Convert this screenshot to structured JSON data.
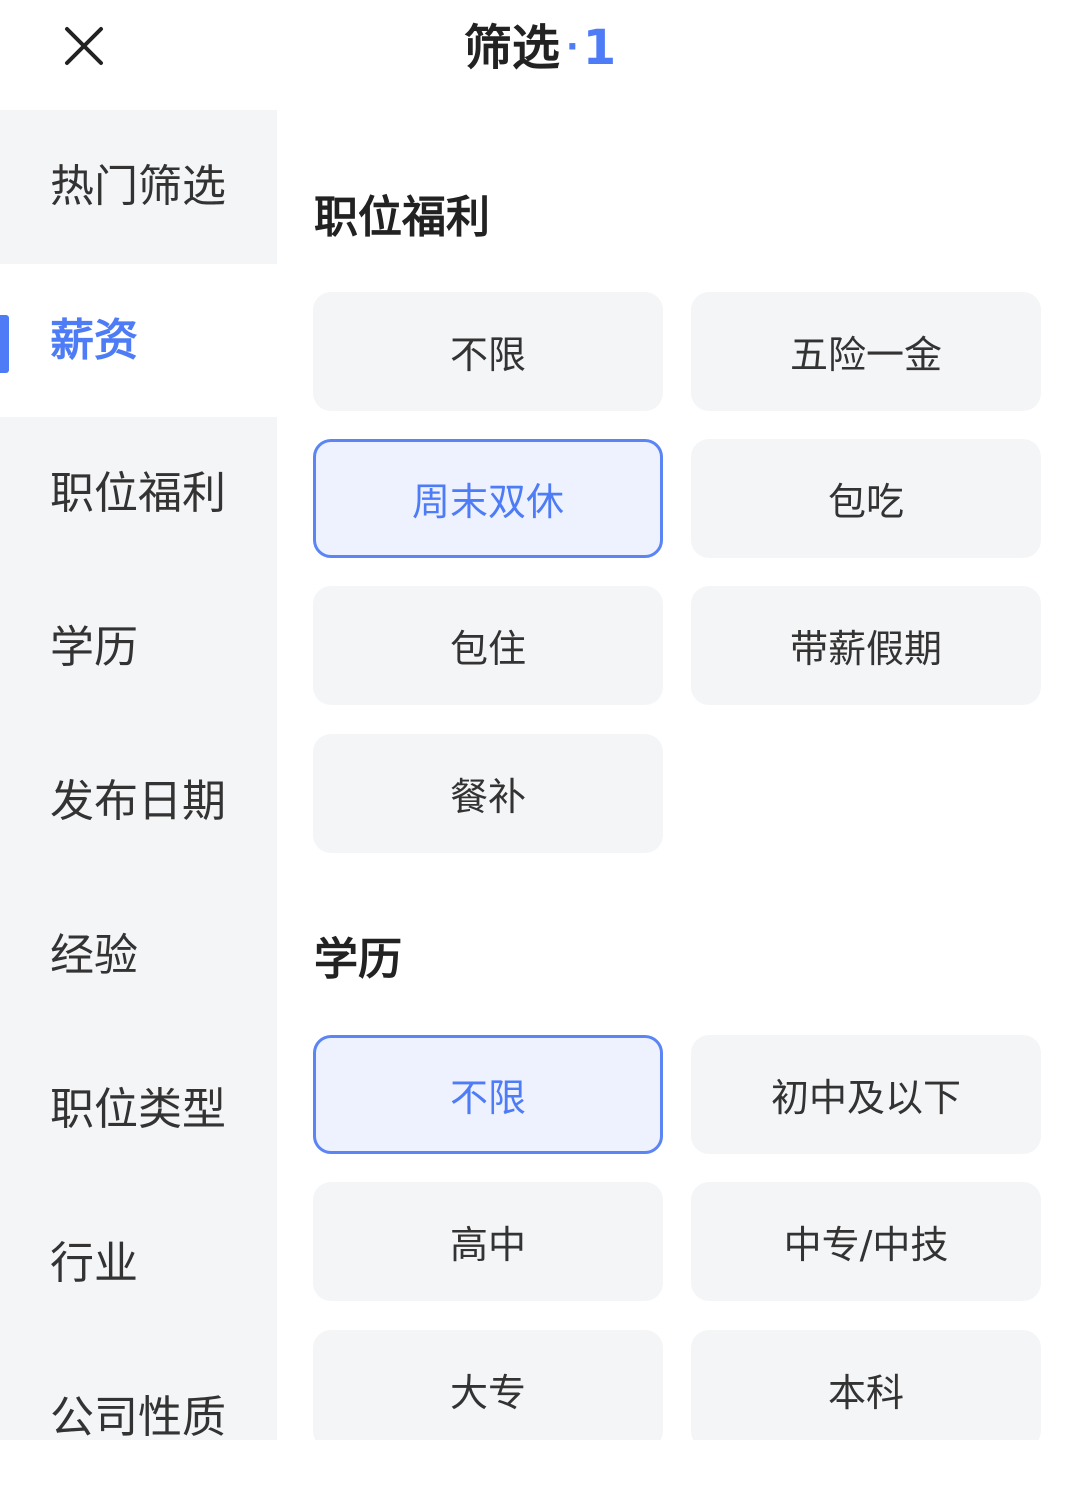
{
  "header": {
    "close_icon": "close-icon",
    "title": "筛选",
    "dot": "·",
    "count": "1"
  },
  "colors": {
    "accent": "#4e7cf6",
    "sidebar_bg": "#f4f5f7",
    "chip_bg": "#f4f5f7",
    "chip_selected_bg": "#eef2fe"
  },
  "sidebar": {
    "items": [
      {
        "label": "热门筛选",
        "active": false
      },
      {
        "label": "薪资",
        "active": true
      },
      {
        "label": "职位福利",
        "active": false
      },
      {
        "label": "学历",
        "active": false
      },
      {
        "label": "发布日期",
        "active": false
      },
      {
        "label": "经验",
        "active": false
      },
      {
        "label": "职位类型",
        "active": false
      },
      {
        "label": "行业",
        "active": false
      },
      {
        "label": "公司性质",
        "active": false
      }
    ]
  },
  "sections": [
    {
      "title": "职位福利",
      "options": [
        {
          "label": "不限",
          "selected": false
        },
        {
          "label": "五险一金",
          "selected": false
        },
        {
          "label": "周末双休",
          "selected": true
        },
        {
          "label": "包吃",
          "selected": false
        },
        {
          "label": "包住",
          "selected": false
        },
        {
          "label": "带薪假期",
          "selected": false
        },
        {
          "label": "餐补",
          "selected": false
        }
      ]
    },
    {
      "title": "学历",
      "options": [
        {
          "label": "不限",
          "selected": true
        },
        {
          "label": "初中及以下",
          "selected": false
        },
        {
          "label": "高中",
          "selected": false
        },
        {
          "label": "中专/中技",
          "selected": false
        },
        {
          "label": "大专",
          "selected": false
        },
        {
          "label": "本科",
          "selected": false
        }
      ]
    }
  ]
}
